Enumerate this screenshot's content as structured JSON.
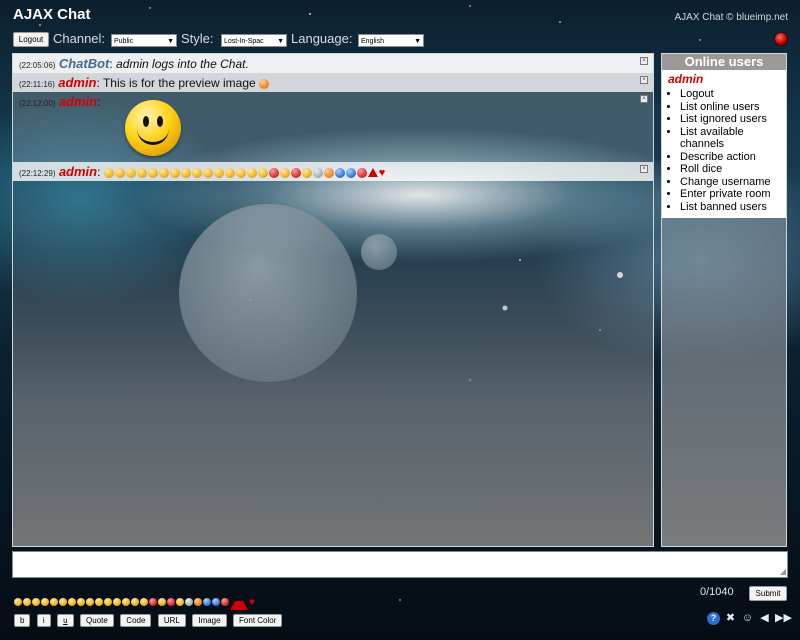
{
  "app": {
    "title": "AJAX Chat",
    "copyright": "AJAX Chat © blueimp.net"
  },
  "toolbar": {
    "logout_label": "Logout",
    "channel_label": "Channel:",
    "channel_value": "Public",
    "style_label": "Style:",
    "style_value": "Lost-In-Spac",
    "language_label": "Language:",
    "language_value": "English"
  },
  "messages": [
    {
      "time": "(22:05:06)",
      "nick": "ChatBot",
      "sep": ":",
      "text": " admin logs into the Chat."
    },
    {
      "time": "(22:11:16)",
      "nick": "admin",
      "sep": ":",
      "text": " This is for the preview image"
    },
    {
      "time": "(22:12:00)",
      "nick": "admin",
      "sep": ":",
      "text": ""
    },
    {
      "time": "(22:12:29)",
      "nick": "admin",
      "sep": ":",
      "text": ""
    }
  ],
  "online": {
    "header": "Online users",
    "user": "admin",
    "menu": [
      "Logout",
      "List online users",
      "List ignored users",
      "List available channels",
      "Describe action",
      "Roll dice",
      "Change username",
      "Enter private room",
      "List banned users"
    ]
  },
  "input": {
    "value": "",
    "char_count": "0/1040",
    "submit_label": "Submit"
  },
  "format_buttons": {
    "bold": "b",
    "italic": "i",
    "underline": "u",
    "quote": "Quote",
    "code": "Code",
    "url": "URL",
    "image": "Image",
    "font_color": "Font Color"
  },
  "icons": {
    "status": "status-red-icon",
    "help": "help-icon",
    "settings": "settings-icon",
    "users": "users-icon",
    "sound": "sound-icon",
    "autoscroll": "fast-forward-icon"
  },
  "colors": {
    "admin_nick": "#d60000",
    "bot_nick": "#486b8c",
    "online_header_bg": "#9a9a9a"
  }
}
